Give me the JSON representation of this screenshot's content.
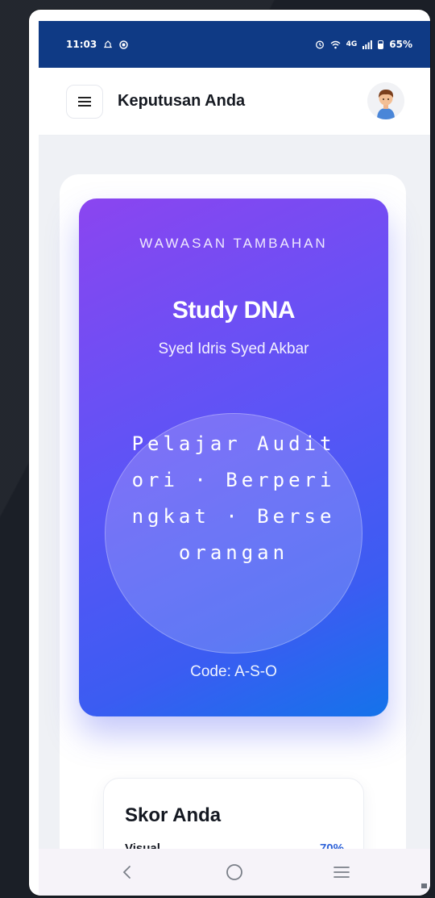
{
  "status_bar": {
    "time": "11:03",
    "network": "4G",
    "battery": "65%"
  },
  "header": {
    "title": "Keputusan Anda"
  },
  "dna_card": {
    "eyebrow": "WAWASAN TAMBAHAN",
    "title": "Study DNA",
    "name": "Syed Idris Syed Akbar",
    "profile": "Pelajar Auditori · Berperingkat · Berseorangan",
    "code": "Code: A-S-O"
  },
  "scores": {
    "title": "Skor Anda",
    "items": [
      {
        "label": "Visual",
        "value": "70%"
      }
    ]
  },
  "icons": {
    "menu": "menu-icon",
    "avatar": "avatar-icon",
    "nav_back": "back-icon",
    "nav_home": "home-icon",
    "nav_recents": "recents-icon"
  },
  "colors": {
    "status_bar": "#0f3a85",
    "card_gradient_start": "#8b45f0",
    "card_gradient_end": "#1473ea",
    "score_accent": "#2f63d8"
  }
}
